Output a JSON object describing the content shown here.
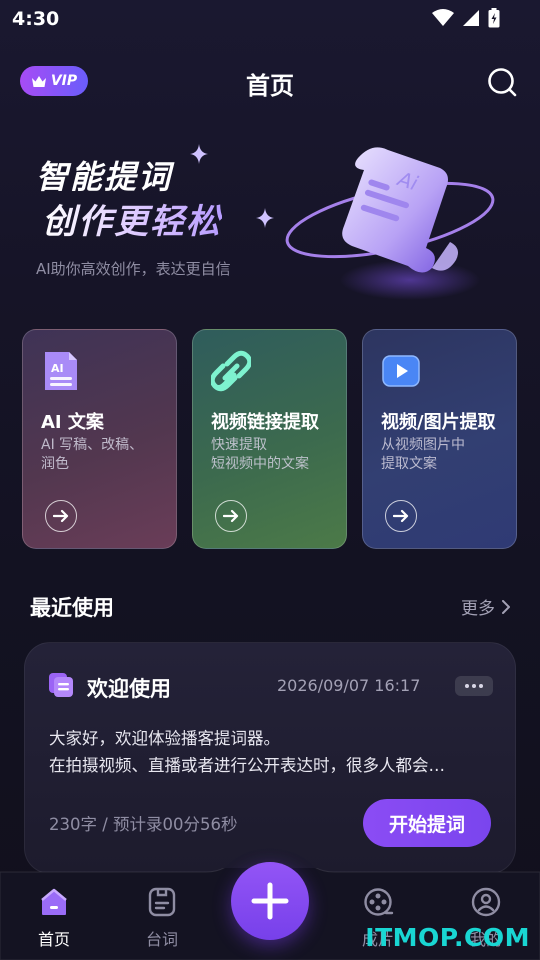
{
  "status_bar": {
    "time": "4:30"
  },
  "header": {
    "vip_label": "VIP",
    "title": "首页"
  },
  "hero": {
    "line1": "智能提词",
    "line2": "创作更轻松",
    "subtitle": "AI助你高效创作，表达更自信"
  },
  "features": [
    {
      "title": "AI 文案",
      "desc": "AI 写稿、改稿、\n润色",
      "icon": "ai-doc-icon"
    },
    {
      "title": "视频链接提取",
      "desc": "快速提取\n短视频中的文案",
      "icon": "link-icon"
    },
    {
      "title": "视频/图片提取",
      "desc": "从视频图片中\n提取文案",
      "icon": "video-play-icon"
    }
  ],
  "recent": {
    "section_title": "最近使用",
    "more_label": "更多",
    "card": {
      "title": "欢迎使用",
      "date": "2026/09/07  16:17",
      "body_line1": "大家好，欢迎体验播客提词器。",
      "body_line2": "在拍摄视频、直播或者进行公开表达时，很多人都会…",
      "meta": "230字 / 预计录00分56秒",
      "start_label": "开始提词"
    }
  },
  "tabbar": {
    "tabs": [
      {
        "label": "首页",
        "active": true
      },
      {
        "label": "台词",
        "active": false
      },
      {
        "label": "成片",
        "active": false
      },
      {
        "label": "我的",
        "active": false
      }
    ]
  },
  "watermark": "ITMOP.COM",
  "colors": {
    "accent": "#8b4cf4",
    "background": "#161427",
    "watermark": "#19d6d3"
  }
}
